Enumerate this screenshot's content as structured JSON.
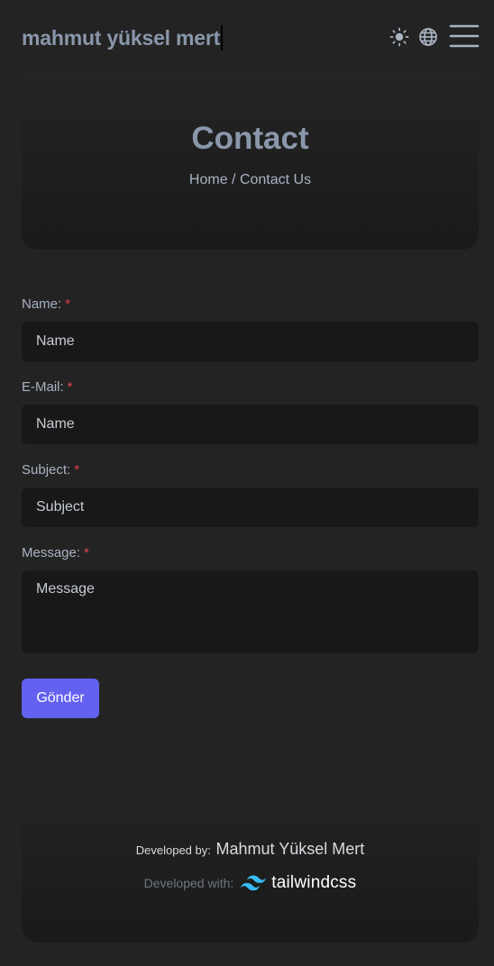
{
  "header": {
    "brand": "mahmut yüksel mert",
    "icons": [
      "sun-icon",
      "globe-icon",
      "menu-icon"
    ]
  },
  "hero": {
    "title": "Contact",
    "breadcrumb": "Home / Contact Us"
  },
  "form": {
    "required_mark": "*",
    "name": {
      "label": "Name:",
      "placeholder": "Name"
    },
    "email": {
      "label": "E-Mail:",
      "placeholder": "Name"
    },
    "subject": {
      "label": "Subject:",
      "placeholder": "Subject"
    },
    "message": {
      "label": "Message:",
      "placeholder": "Message"
    },
    "submit_label": "Gönder"
  },
  "footer": {
    "developed_by_label": "Developed by:",
    "developer_name": "Mahmut Yüksel Mert",
    "developed_with_label": "Developed with:",
    "tech_name": "tailwindcss"
  },
  "colors": {
    "background": "#232323",
    "accent": "#6361f0",
    "required": "#e0424b",
    "tailwind": "#38bdf8"
  }
}
